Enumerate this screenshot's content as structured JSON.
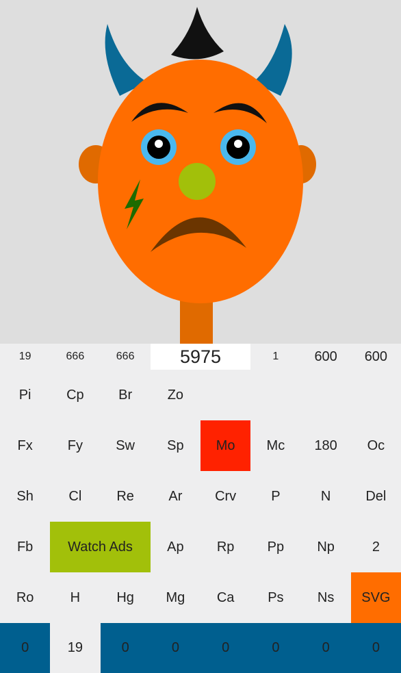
{
  "colors": {
    "background": "#eeeeef",
    "face": "#ff6d00",
    "blue": "#005f8f",
    "red": "#ff2200",
    "green": "#a2c00a",
    "orange": "#ff6d00"
  },
  "rows": [
    [
      {
        "t": "19",
        "c": 0,
        "small": true
      },
      {
        "t": "666",
        "c": 1,
        "small": true
      },
      {
        "t": "666",
        "c": 2,
        "small": true
      },
      {
        "t": "5975",
        "c": 3,
        "span": 2,
        "bg": "#ffffff",
        "big": true
      },
      {
        "t": "1",
        "c": 5,
        "small": true
      },
      {
        "t": "600",
        "c": 6
      },
      {
        "t": "600",
        "c": 7
      }
    ],
    [
      {
        "t": "Pi",
        "c": 0
      },
      {
        "t": "Cp",
        "c": 1
      },
      {
        "t": "Br",
        "c": 2
      },
      {
        "t": "Zo",
        "c": 3
      }
    ],
    [
      {
        "t": "Fx",
        "c": 0
      },
      {
        "t": "Fy",
        "c": 1
      },
      {
        "t": "Sw",
        "c": 2
      },
      {
        "t": "Sp",
        "c": 3
      },
      {
        "t": "Mo",
        "c": 4,
        "bg": "#ff2200"
      },
      {
        "t": "Mc",
        "c": 5
      },
      {
        "t": "180",
        "c": 6
      },
      {
        "t": "Oc",
        "c": 7
      }
    ],
    [
      {
        "t": "Sh",
        "c": 0
      },
      {
        "t": "Cl",
        "c": 1
      },
      {
        "t": "Re",
        "c": 2
      },
      {
        "t": "Ar",
        "c": 3
      },
      {
        "t": "Crv",
        "c": 4
      },
      {
        "t": "P",
        "c": 5
      },
      {
        "t": "N",
        "c": 6
      },
      {
        "t": "Del",
        "c": 7
      }
    ],
    [
      {
        "t": "Fb",
        "c": 0
      },
      {
        "t": "Watch Ads",
        "c": 1,
        "span": 2,
        "bg": "#a2c00a"
      },
      {
        "t": "Ap",
        "c": 3
      },
      {
        "t": "Rp",
        "c": 4
      },
      {
        "t": "Pp",
        "c": 5
      },
      {
        "t": "Np",
        "c": 6
      },
      {
        "t": "2",
        "c": 7
      }
    ],
    [
      {
        "t": "Ro",
        "c": 0
      },
      {
        "t": "H",
        "c": 1
      },
      {
        "t": "Hg",
        "c": 2
      },
      {
        "t": "Mg",
        "c": 3
      },
      {
        "t": "Ca",
        "c": 4
      },
      {
        "t": "Ps",
        "c": 5
      },
      {
        "t": "Ns",
        "c": 6
      },
      {
        "t": "SVG",
        "c": 7,
        "bg": "#ff6d00"
      }
    ],
    [
      {
        "t": "0",
        "c": 0,
        "bg": "#005f8f"
      },
      {
        "t": "19",
        "c": 1
      },
      {
        "t": "0",
        "c": 2,
        "bg": "#005f8f"
      },
      {
        "t": "0",
        "c": 3,
        "bg": "#005f8f"
      },
      {
        "t": "0",
        "c": 4,
        "bg": "#005f8f"
      },
      {
        "t": "0",
        "c": 5,
        "bg": "#005f8f"
      },
      {
        "t": "0",
        "c": 6,
        "bg": "#005f8f"
      },
      {
        "t": "0",
        "c": 7,
        "bg": "#005f8f"
      }
    ]
  ]
}
